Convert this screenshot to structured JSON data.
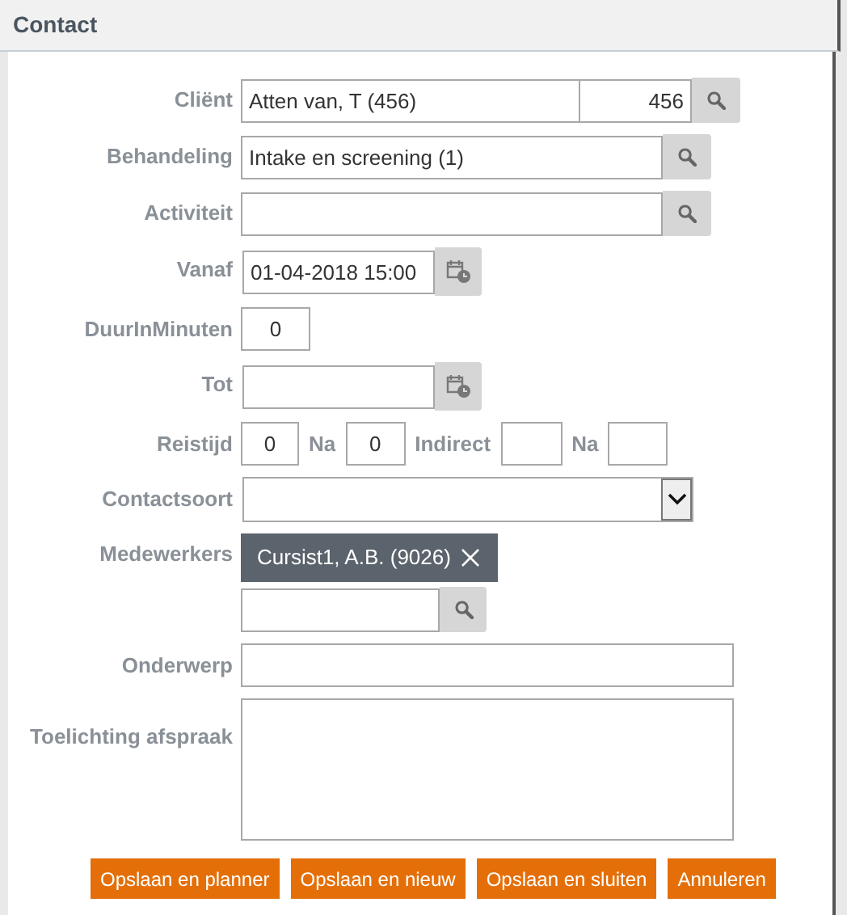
{
  "window": {
    "title": "Contact"
  },
  "fields": [
    {
      "kind": "lookup",
      "label": "Cliënt",
      "value": "Atten van, T (456)",
      "code": "456"
    },
    {
      "kind": "search",
      "label": "Behandeling",
      "value": "Intake en screening (1)"
    },
    {
      "kind": "search",
      "label": "Activiteit"
    },
    {
      "kind": "datetime",
      "label": "Vanaf",
      "value": "01-04-2018 15:00"
    },
    {
      "kind": "number",
      "label": "DuurInMinuten",
      "value": "0"
    },
    {
      "kind": "datetime",
      "label": "Tot"
    },
    {
      "kind": "travel",
      "label": "Reistijd",
      "value": "0",
      "parts": [
        {
          "label": "Na",
          "value": "0"
        },
        {
          "label": "Indirect"
        },
        {
          "label": "Na"
        }
      ]
    },
    {
      "kind": "select",
      "label": "Contactsoort"
    },
    {
      "kind": "tags",
      "label": "Medewerkers",
      "tags": [
        "Cursist1, A.B. (9026)"
      ]
    },
    {
      "kind": "text",
      "label": "Onderwerp"
    },
    {
      "kind": "textarea",
      "label": "Toelichting afspraak"
    }
  ],
  "buttons": [
    "Opslaan en planner",
    "Opslaan en nieuw",
    "Opslaan en sluiten",
    "Annuleren"
  ]
}
